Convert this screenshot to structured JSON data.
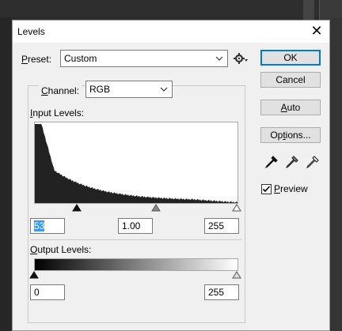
{
  "dialog": {
    "title": "Levels",
    "close_icon": "close-icon"
  },
  "preset": {
    "label": "Preset:",
    "value": "Custom",
    "options_icon": "gear-icon"
  },
  "channel": {
    "label": "Channel:",
    "value": "RGB"
  },
  "input_levels": {
    "label": "Input Levels:",
    "black": "53",
    "gamma": "1.00",
    "white": "255"
  },
  "output_levels": {
    "label": "Output Levels:",
    "black": "0",
    "white": "255"
  },
  "buttons": {
    "ok": "OK",
    "cancel": "Cancel",
    "auto": "Auto",
    "options": "Options..."
  },
  "eyedroppers": [
    "black-point-eyedropper-icon",
    "gray-point-eyedropper-icon",
    "white-point-eyedropper-icon"
  ],
  "preview": {
    "label": "Preview",
    "checked": true
  },
  "histogram": {
    "color": "#222222",
    "shape": "decaying curve, peak at left, falling toward right"
  }
}
